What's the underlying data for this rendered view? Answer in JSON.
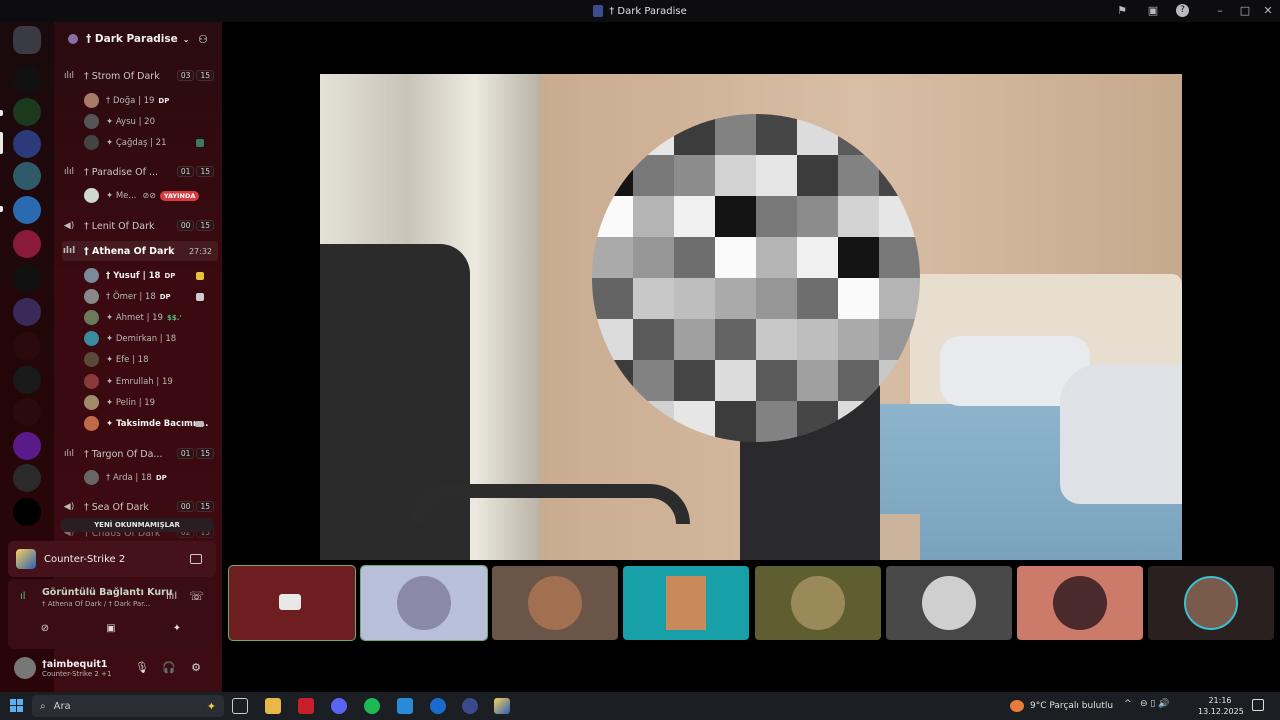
{
  "window": {
    "title": "† Dark Paradise"
  },
  "server": {
    "name": "† Dark Paradise"
  },
  "channels": [
    {
      "name": "† Strom Of Dark",
      "count": "03",
      "limit": "15"
    },
    {
      "name": "† Paradise Of ...",
      "count": "01",
      "limit": "15"
    },
    {
      "name": "† Lenit Of Dark",
      "count": "00",
      "limit": "15"
    },
    {
      "name": "† Athena Of Dark",
      "timer": "27:32"
    },
    {
      "name": "† Targon Of Da...",
      "count": "01",
      "limit": "15"
    },
    {
      "name": "† Sea Of Dark",
      "count": "00",
      "limit": "15"
    },
    {
      "name": "† Chaos Of Dark",
      "count": "02",
      "limit": "15"
    }
  ],
  "members": {
    "strom": [
      {
        "name": "† Doğa | 19",
        "badge": "DP"
      },
      {
        "name": "✦ Aysu | 20"
      },
      {
        "name": "✦ Çağdaş | 21"
      }
    ],
    "paradise": [
      {
        "name": "✦ Me...",
        "live": "YAYINDA"
      }
    ],
    "athena": [
      {
        "name": "† Yusuf | 18",
        "badge": "DP"
      },
      {
        "name": "† Ömer | 18",
        "badge": "DP"
      },
      {
        "name": "✦ Ahmet | 19",
        "badge": "$$.'"
      },
      {
        "name": "✦ Demirkan | 18"
      },
      {
        "name": "✦ Efe | 18"
      },
      {
        "name": "✦ Emrullah | 19"
      },
      {
        "name": "✦ Pelin | 19"
      },
      {
        "name": "✦ Taksimde Bacımı ..."
      }
    ],
    "targon": [
      {
        "name": "† Arda | 18",
        "badge": "DP"
      }
    ]
  },
  "unread_pill": "YENİ OKUNMAMIŞLAR",
  "activity": {
    "game": "Counter-Strike 2"
  },
  "voice": {
    "status": "Görüntülü Bağlantı Kuru",
    "location": "† Athena Of Dark / † Dark Par..."
  },
  "user": {
    "name": "†aimbequit1",
    "status": "Counter-Strike 2 +1"
  },
  "taskbar": {
    "search_placeholder": "Ara",
    "weather": "9°C  Parçalı bulutlu",
    "time": "21:16",
    "date": "13.12.2025"
  },
  "colors": {
    "accent_red": "#d83c3e",
    "panel_bg": "#3a0a10",
    "connected_green": "#4fc27a"
  }
}
